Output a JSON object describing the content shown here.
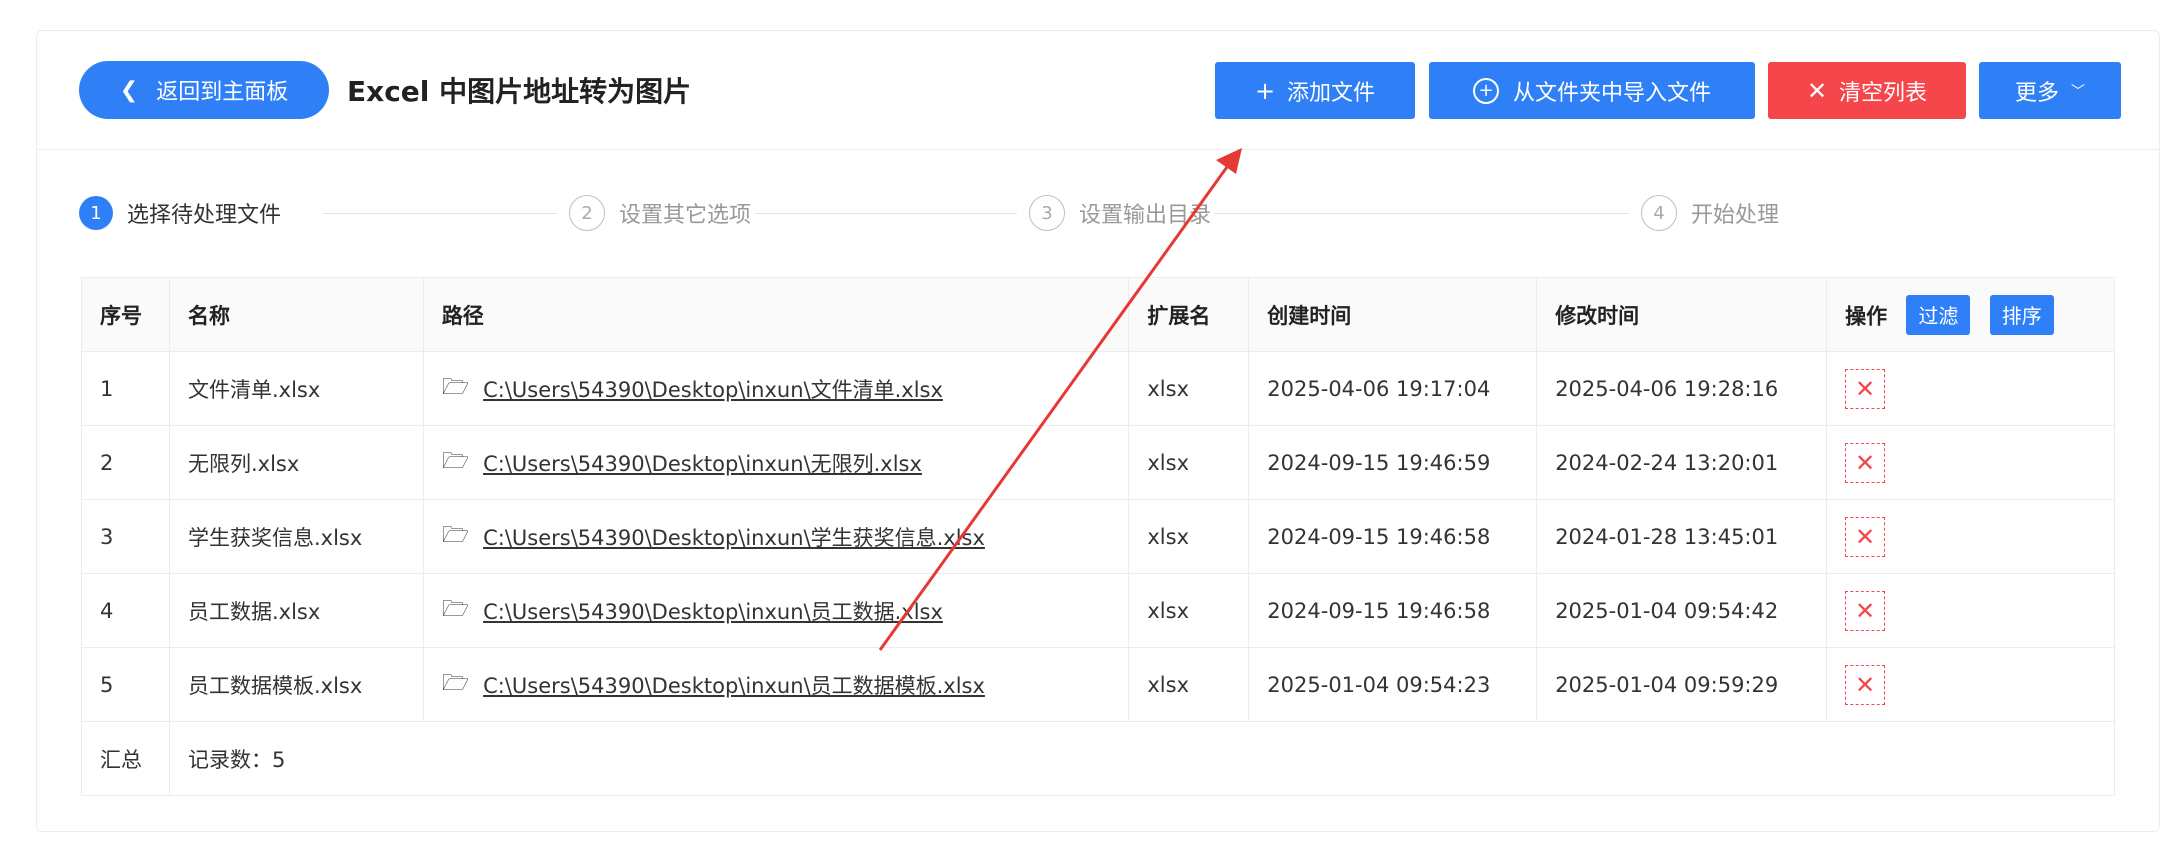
{
  "header": {
    "back_label": "返回到主面板",
    "title": "Excel 中图片地址转为图片",
    "add_file": "添加文件",
    "import_folder": "从文件夹中导入文件",
    "clear_list": "清空列表",
    "more": "更多"
  },
  "steps": [
    {
      "num": "1",
      "label": "选择待处理文件"
    },
    {
      "num": "2",
      "label": "设置其它选项"
    },
    {
      "num": "3",
      "label": "设置输出目录"
    },
    {
      "num": "4",
      "label": "开始处理"
    }
  ],
  "table": {
    "columns": {
      "index": "序号",
      "name": "名称",
      "path": "路径",
      "ext": "扩展名",
      "created": "创建时间",
      "modified": "修改时间",
      "actions": "操作",
      "filter": "过滤",
      "sort": "排序"
    },
    "rows": [
      {
        "index": "1",
        "name": "文件清单.xlsx",
        "path": "C:\\Users\\54390\\Desktop\\inxun\\文件清单.xlsx",
        "ext": "xlsx",
        "created": "2025-04-06 19:17:04",
        "modified": "2025-04-06 19:28:16"
      },
      {
        "index": "2",
        "name": "无限列.xlsx",
        "path": "C:\\Users\\54390\\Desktop\\inxun\\无限列.xlsx",
        "ext": "xlsx",
        "created": "2024-09-15 19:46:59",
        "modified": "2024-02-24 13:20:01"
      },
      {
        "index": "3",
        "name": "学生获奖信息.xlsx",
        "path": "C:\\Users\\54390\\Desktop\\inxun\\学生获奖信息.xlsx",
        "ext": "xlsx",
        "created": "2024-09-15 19:46:58",
        "modified": "2024-01-28 13:45:01"
      },
      {
        "index": "4",
        "name": "员工数据.xlsx",
        "path": "C:\\Users\\54390\\Desktop\\inxun\\员工数据.xlsx",
        "ext": "xlsx",
        "created": "2024-09-15 19:46:58",
        "modified": "2025-01-04 09:54:42"
      },
      {
        "index": "5",
        "name": "员工数据模板.xlsx",
        "path": "C:\\Users\\54390\\Desktop\\inxun\\员工数据模板.xlsx",
        "ext": "xlsx",
        "created": "2025-01-04 09:54:23",
        "modified": "2025-01-04 09:59:29"
      }
    ],
    "summary": {
      "label": "汇总",
      "count": "记录数：5"
    }
  },
  "colors": {
    "primary": "#2f80f7",
    "danger": "#f5464b",
    "annotation_arrow": "#e53935"
  }
}
